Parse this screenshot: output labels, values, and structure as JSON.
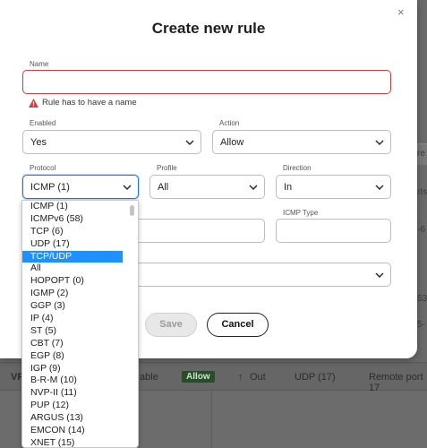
{
  "background": {
    "row": {
      "vpc_label": "VP",
      "enabled_text": "able",
      "action_badge": "Allow",
      "direction_icon": "arrow-up-icon",
      "direction": "Out",
      "protocol": "UDP (17)",
      "port": "Remote port 17"
    },
    "right_fragments": [
      "re",
      "rts",
      "-6",
      "53",
      "5-"
    ]
  },
  "modal": {
    "title": "Create new rule",
    "close_icon": "close-icon",
    "name": {
      "label": "Name",
      "value": "",
      "error": "Rule has to have a name"
    },
    "enabled": {
      "label": "Enabled",
      "value": "Yes"
    },
    "action": {
      "label": "Action",
      "value": "Allow"
    },
    "protocol": {
      "label": "Protocol",
      "value": "ICMP (1)"
    },
    "profile": {
      "label": "Profile",
      "value": "All"
    },
    "direction": {
      "label": "Direction",
      "value": "In"
    },
    "icmp_type": {
      "label": "ICMP Type",
      "value": ""
    },
    "save_label": "Save",
    "cancel_label": "Cancel"
  },
  "protocol_options": [
    "ICMP (1)",
    "ICMPv6 (58)",
    "TCP (6)",
    "UDP (17)",
    "TCP/UDP",
    "All",
    "HOPOPT (0)",
    "IGMP (2)",
    "GGP (3)",
    "IP (4)",
    "ST (5)",
    "CBT (7)",
    "EGP (8)",
    "IGP (9)",
    "B-R-M (10)",
    "NVP-II (11)",
    "PUP (12)",
    "ARGUS (13)",
    "EMCON (14)",
    "XNET (15)"
  ],
  "selected_option": "TCP/UDP",
  "colors": {
    "error": "#d43a3a",
    "focus": "#1b75e0",
    "selected": "#1e90ff",
    "allow_badge": "#2c4a2c"
  }
}
